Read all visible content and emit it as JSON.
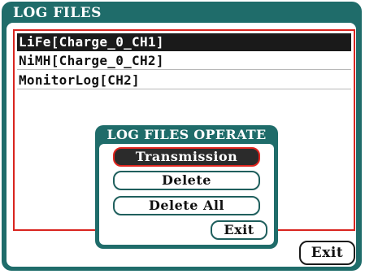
{
  "window": {
    "title": "LOG FILES"
  },
  "file_list": {
    "items": [
      {
        "label": "LiFe[Charge_0_CH1]",
        "selected": true
      },
      {
        "label": "NiMH[Charge_0_CH2]",
        "selected": false
      },
      {
        "label": "MonitorLog[CH2]",
        "selected": false
      }
    ]
  },
  "dialog": {
    "title": "LOG FILES OPERATE",
    "buttons": {
      "transmission": "Transmission",
      "delete": "Delete",
      "delete_all": "Delete All",
      "exit": "Exit"
    },
    "focused_button": "transmission"
  },
  "footer": {
    "exit_label": "Exit"
  },
  "colors": {
    "frame": "#1f6c6a",
    "selection": "#1a1a1a",
    "focus_border": "#d9241f"
  }
}
